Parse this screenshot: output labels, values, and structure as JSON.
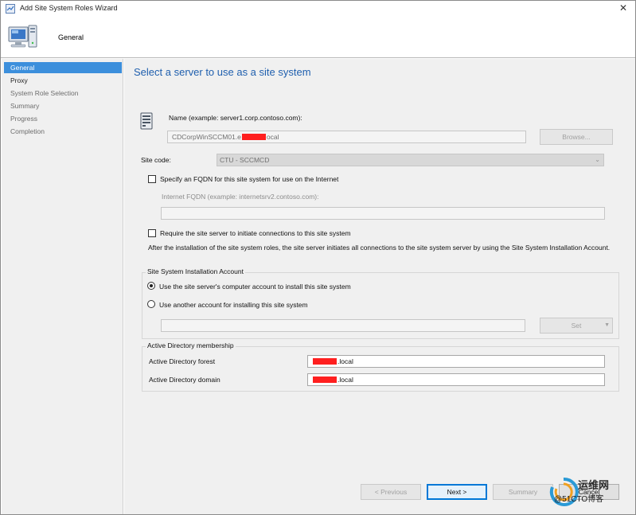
{
  "window": {
    "title": "Add Site System Roles Wizard",
    "close_glyph": "✕"
  },
  "header": {
    "title": "General",
    "icon": "computer-icon"
  },
  "sidebar": {
    "items": [
      {
        "label": "General",
        "state": "active"
      },
      {
        "label": "Proxy",
        "state": "enabled"
      },
      {
        "label": "System Role Selection",
        "state": "disabled"
      },
      {
        "label": "Summary",
        "state": "disabled"
      },
      {
        "label": "Progress",
        "state": "disabled"
      },
      {
        "label": "Completion",
        "state": "disabled"
      }
    ]
  },
  "main": {
    "heading": "Select a server to use as a site system",
    "name_label": "Name (example: server1.corp.contoso.com):",
    "name_value_prefix": "CDCorpWinSCCM01.e",
    "name_value_suffix": "ocal",
    "browse_label": "Browse...",
    "site_code_label": "Site code:",
    "site_code_value": "CTU - SCCMCD",
    "fqdn_checkbox_label": "Specify an FQDN for this site system for use on the Internet",
    "fqdn_checked": false,
    "internet_fqdn_label": "Internet FQDN (example: internetsrv2.contoso.com):",
    "internet_fqdn_value": "",
    "require_checkbox_label": "Require the site server to initiate connections to this site system",
    "require_checked": false,
    "require_desc": "After the  installation of the site system roles, the site server initiates all connections to the site system server by using the Site System Installation Account.",
    "install_account": {
      "title": "Site System Installation Account",
      "option_computer": "Use the site server's computer account to install this site system",
      "option_another": "Use another account for installing this site system",
      "selected": "computer",
      "account_value": "",
      "set_label": "Set",
      "set_arrow": "▼"
    },
    "ad": {
      "title": "Active Directory membership",
      "forest_label": "Active Directory forest",
      "forest_suffix": ".local",
      "domain_label": "Active Directory domain",
      "domain_suffix": ".local"
    }
  },
  "footer": {
    "previous": "< Previous",
    "next": "Next >",
    "summary": "Summary",
    "cancel": "Cancel"
  },
  "watermark": {
    "text_cn": "运维网",
    "text_url": "@51CTO博客"
  },
  "colors": {
    "accent": "#1f5fae",
    "selected_nav": "#3c8fdc",
    "redaction": "#ff1f1f"
  }
}
